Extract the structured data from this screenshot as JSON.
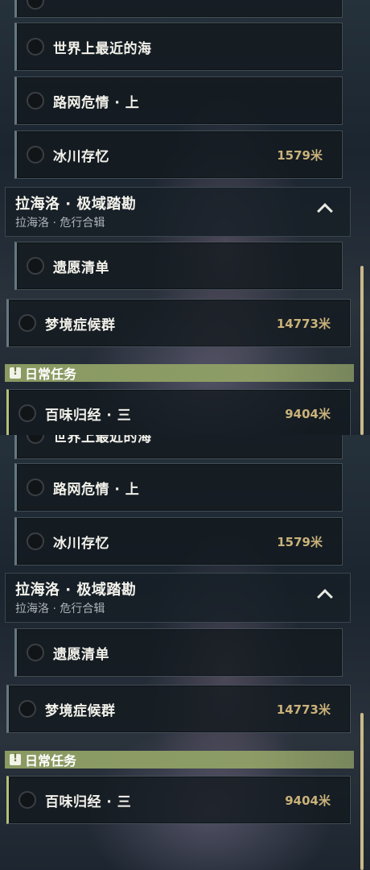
{
  "panels": [
    {
      "quests_top": [
        {
          "title": "世界上最近的海",
          "distance": ""
        },
        {
          "title": "路网危情 · 上",
          "distance": ""
        },
        {
          "title": "冰川存忆",
          "distance": "1579米"
        }
      ],
      "chapter": {
        "title": "拉海洛 · 极域踏勘",
        "subtitle": "拉海洛 · 危行合辑"
      },
      "quests_chapter": [
        {
          "title": "遗愿清单",
          "distance": ""
        },
        {
          "title": "梦境症候群",
          "distance": "14773米"
        }
      ],
      "daily_header": "日常任务",
      "daily_quests": [
        {
          "title": "百味归经 · 三",
          "distance": "9404米"
        }
      ]
    },
    {
      "quests_top": [
        {
          "title": "世界上最近的海",
          "distance": ""
        },
        {
          "title": "路网危情 · 上",
          "distance": ""
        },
        {
          "title": "冰川存忆",
          "distance": "1579米"
        }
      ],
      "chapter": {
        "title": "拉海洛 · 极域踏勘",
        "subtitle": "拉海洛 · 危行合辑"
      },
      "quests_chapter": [
        {
          "title": "遗愿清单",
          "distance": ""
        },
        {
          "title": "梦境症候群",
          "distance": "14773米"
        }
      ],
      "daily_header": "日常任务",
      "daily_quests": [
        {
          "title": "百味归经 · 三",
          "distance": "9404米"
        }
      ]
    }
  ],
  "colors": {
    "accent": "#c9b27a",
    "daily_bar": "#8a9a62",
    "scroll_thumb": "#c9b98a"
  }
}
